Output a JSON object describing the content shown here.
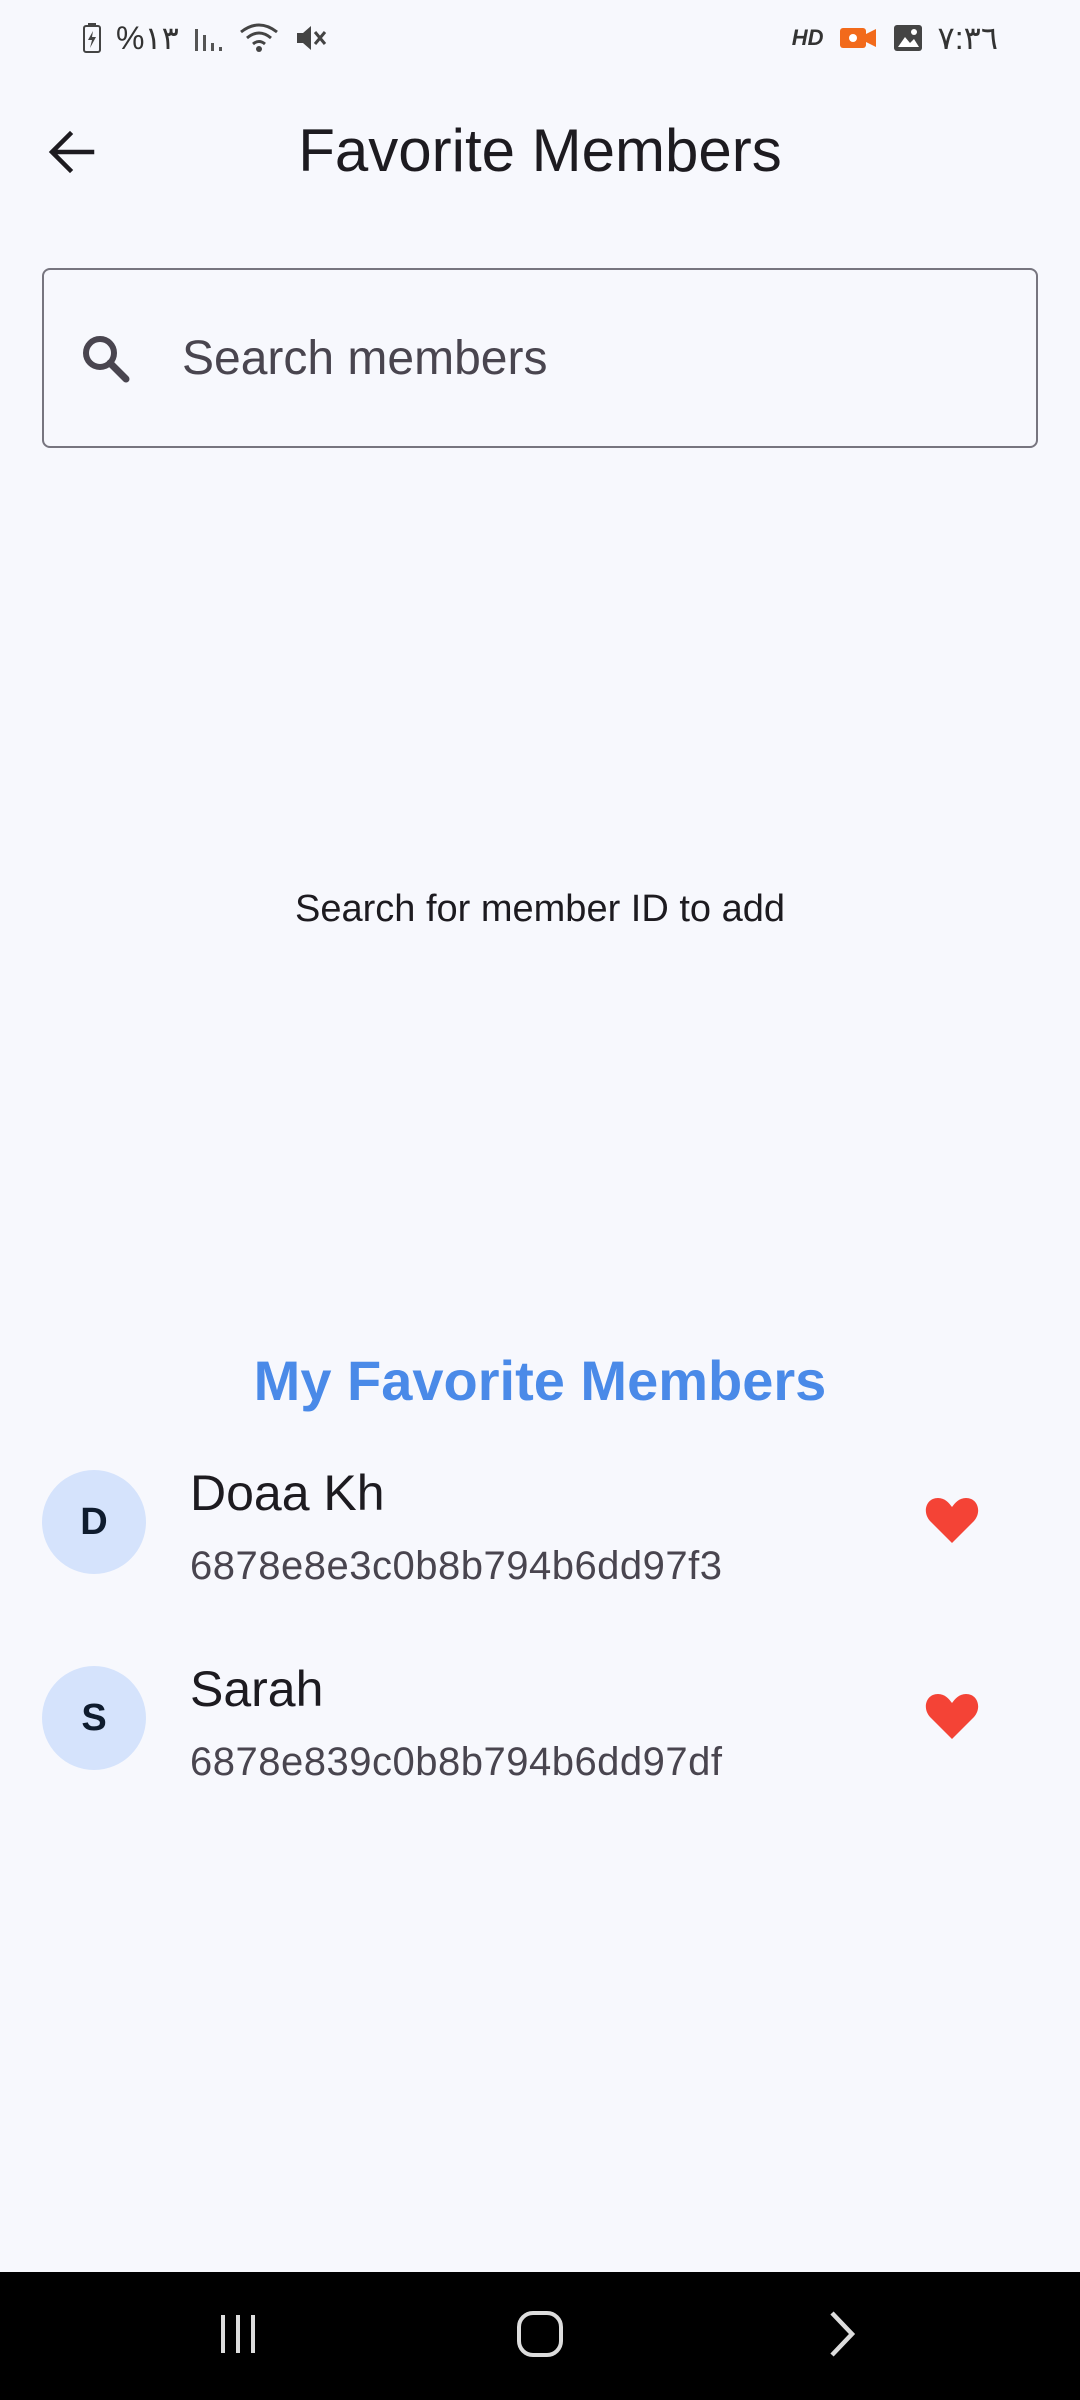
{
  "status_bar": {
    "battery": "%١٣",
    "time": "٧:٣٦",
    "hd_badge": "HD"
  },
  "header": {
    "title": "Favorite Members",
    "back_icon": "arrow-left-icon"
  },
  "search": {
    "placeholder": "Search members",
    "value": "",
    "icon": "search-icon"
  },
  "empty_state": {
    "text": "Search for member ID to add"
  },
  "favorites": {
    "heading": "My Favorite Members",
    "heading_color": "#4a8ae8",
    "items": [
      {
        "initial": "D",
        "name": "Doaa Kh",
        "id": "6878e8e3c0b8b794b6dd97f3",
        "icon": "heart-icon"
      },
      {
        "initial": "S",
        "name": "Sarah",
        "id": "6878e839c0b8b794b6dd97df",
        "icon": "heart-icon"
      }
    ]
  },
  "colors": {
    "background": "#f7f8fd",
    "avatar_bg": "#d5e3fc",
    "heart": "#f44336",
    "accent": "#4a8ae8"
  },
  "nav_bar": {
    "recent_icon": "recent-apps-icon",
    "home_icon": "home-icon",
    "back_icon": "back-chevron-icon"
  }
}
